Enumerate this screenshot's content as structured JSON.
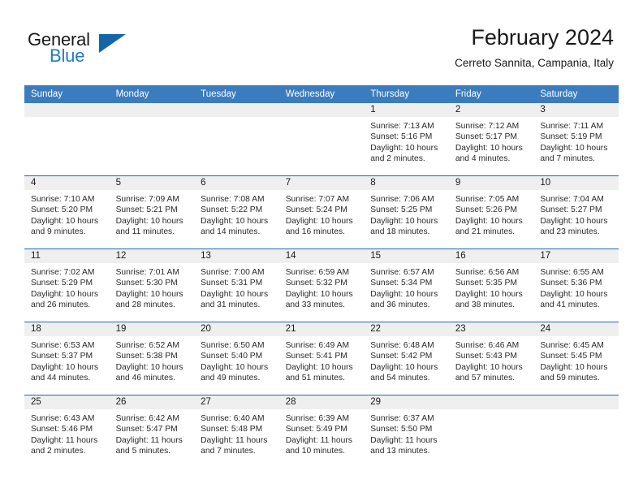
{
  "brand": {
    "name_part1": "General",
    "name_part2": "Blue",
    "flag_icon": "triangle-flag-icon"
  },
  "header": {
    "title": "February 2024",
    "subtitle": "Cerreto Sannita, Campania, Italy"
  },
  "calendar": {
    "weekday_headers": [
      "Sunday",
      "Monday",
      "Tuesday",
      "Wednesday",
      "Thursday",
      "Friday",
      "Saturday"
    ],
    "accent_color": "#3b7cbe",
    "row_divider_color": "#1f6bb0",
    "daynum_bar_color": "#efefef",
    "weeks": [
      [
        {
          "day": "",
          "empty": true,
          "sunrise": "",
          "sunset": "",
          "daylight_line1": "",
          "daylight_line2": ""
        },
        {
          "day": "",
          "empty": true,
          "sunrise": "",
          "sunset": "",
          "daylight_line1": "",
          "daylight_line2": ""
        },
        {
          "day": "",
          "empty": true,
          "sunrise": "",
          "sunset": "",
          "daylight_line1": "",
          "daylight_line2": ""
        },
        {
          "day": "",
          "empty": true,
          "sunrise": "",
          "sunset": "",
          "daylight_line1": "",
          "daylight_line2": ""
        },
        {
          "day": "1",
          "empty": false,
          "sunrise": "Sunrise: 7:13 AM",
          "sunset": "Sunset: 5:16 PM",
          "daylight_line1": "Daylight: 10 hours",
          "daylight_line2": "and 2 minutes."
        },
        {
          "day": "2",
          "empty": false,
          "sunrise": "Sunrise: 7:12 AM",
          "sunset": "Sunset: 5:17 PM",
          "daylight_line1": "Daylight: 10 hours",
          "daylight_line2": "and 4 minutes."
        },
        {
          "day": "3",
          "empty": false,
          "sunrise": "Sunrise: 7:11 AM",
          "sunset": "Sunset: 5:19 PM",
          "daylight_line1": "Daylight: 10 hours",
          "daylight_line2": "and 7 minutes."
        }
      ],
      [
        {
          "day": "4",
          "empty": false,
          "sunrise": "Sunrise: 7:10 AM",
          "sunset": "Sunset: 5:20 PM",
          "daylight_line1": "Daylight: 10 hours",
          "daylight_line2": "and 9 minutes."
        },
        {
          "day": "5",
          "empty": false,
          "sunrise": "Sunrise: 7:09 AM",
          "sunset": "Sunset: 5:21 PM",
          "daylight_line1": "Daylight: 10 hours",
          "daylight_line2": "and 11 minutes."
        },
        {
          "day": "6",
          "empty": false,
          "sunrise": "Sunrise: 7:08 AM",
          "sunset": "Sunset: 5:22 PM",
          "daylight_line1": "Daylight: 10 hours",
          "daylight_line2": "and 14 minutes."
        },
        {
          "day": "7",
          "empty": false,
          "sunrise": "Sunrise: 7:07 AM",
          "sunset": "Sunset: 5:24 PM",
          "daylight_line1": "Daylight: 10 hours",
          "daylight_line2": "and 16 minutes."
        },
        {
          "day": "8",
          "empty": false,
          "sunrise": "Sunrise: 7:06 AM",
          "sunset": "Sunset: 5:25 PM",
          "daylight_line1": "Daylight: 10 hours",
          "daylight_line2": "and 18 minutes."
        },
        {
          "day": "9",
          "empty": false,
          "sunrise": "Sunrise: 7:05 AM",
          "sunset": "Sunset: 5:26 PM",
          "daylight_line1": "Daylight: 10 hours",
          "daylight_line2": "and 21 minutes."
        },
        {
          "day": "10",
          "empty": false,
          "sunrise": "Sunrise: 7:04 AM",
          "sunset": "Sunset: 5:27 PM",
          "daylight_line1": "Daylight: 10 hours",
          "daylight_line2": "and 23 minutes."
        }
      ],
      [
        {
          "day": "11",
          "empty": false,
          "sunrise": "Sunrise: 7:02 AM",
          "sunset": "Sunset: 5:29 PM",
          "daylight_line1": "Daylight: 10 hours",
          "daylight_line2": "and 26 minutes."
        },
        {
          "day": "12",
          "empty": false,
          "sunrise": "Sunrise: 7:01 AM",
          "sunset": "Sunset: 5:30 PM",
          "daylight_line1": "Daylight: 10 hours",
          "daylight_line2": "and 28 minutes."
        },
        {
          "day": "13",
          "empty": false,
          "sunrise": "Sunrise: 7:00 AM",
          "sunset": "Sunset: 5:31 PM",
          "daylight_line1": "Daylight: 10 hours",
          "daylight_line2": "and 31 minutes."
        },
        {
          "day": "14",
          "empty": false,
          "sunrise": "Sunrise: 6:59 AM",
          "sunset": "Sunset: 5:32 PM",
          "daylight_line1": "Daylight: 10 hours",
          "daylight_line2": "and 33 minutes."
        },
        {
          "day": "15",
          "empty": false,
          "sunrise": "Sunrise: 6:57 AM",
          "sunset": "Sunset: 5:34 PM",
          "daylight_line1": "Daylight: 10 hours",
          "daylight_line2": "and 36 minutes."
        },
        {
          "day": "16",
          "empty": false,
          "sunrise": "Sunrise: 6:56 AM",
          "sunset": "Sunset: 5:35 PM",
          "daylight_line1": "Daylight: 10 hours",
          "daylight_line2": "and 38 minutes."
        },
        {
          "day": "17",
          "empty": false,
          "sunrise": "Sunrise: 6:55 AM",
          "sunset": "Sunset: 5:36 PM",
          "daylight_line1": "Daylight: 10 hours",
          "daylight_line2": "and 41 minutes."
        }
      ],
      [
        {
          "day": "18",
          "empty": false,
          "sunrise": "Sunrise: 6:53 AM",
          "sunset": "Sunset: 5:37 PM",
          "daylight_line1": "Daylight: 10 hours",
          "daylight_line2": "and 44 minutes."
        },
        {
          "day": "19",
          "empty": false,
          "sunrise": "Sunrise: 6:52 AM",
          "sunset": "Sunset: 5:38 PM",
          "daylight_line1": "Daylight: 10 hours",
          "daylight_line2": "and 46 minutes."
        },
        {
          "day": "20",
          "empty": false,
          "sunrise": "Sunrise: 6:50 AM",
          "sunset": "Sunset: 5:40 PM",
          "daylight_line1": "Daylight: 10 hours",
          "daylight_line2": "and 49 minutes."
        },
        {
          "day": "21",
          "empty": false,
          "sunrise": "Sunrise: 6:49 AM",
          "sunset": "Sunset: 5:41 PM",
          "daylight_line1": "Daylight: 10 hours",
          "daylight_line2": "and 51 minutes."
        },
        {
          "day": "22",
          "empty": false,
          "sunrise": "Sunrise: 6:48 AM",
          "sunset": "Sunset: 5:42 PM",
          "daylight_line1": "Daylight: 10 hours",
          "daylight_line2": "and 54 minutes."
        },
        {
          "day": "23",
          "empty": false,
          "sunrise": "Sunrise: 6:46 AM",
          "sunset": "Sunset: 5:43 PM",
          "daylight_line1": "Daylight: 10 hours",
          "daylight_line2": "and 57 minutes."
        },
        {
          "day": "24",
          "empty": false,
          "sunrise": "Sunrise: 6:45 AM",
          "sunset": "Sunset: 5:45 PM",
          "daylight_line1": "Daylight: 10 hours",
          "daylight_line2": "and 59 minutes."
        }
      ],
      [
        {
          "day": "25",
          "empty": false,
          "sunrise": "Sunrise: 6:43 AM",
          "sunset": "Sunset: 5:46 PM",
          "daylight_line1": "Daylight: 11 hours",
          "daylight_line2": "and 2 minutes."
        },
        {
          "day": "26",
          "empty": false,
          "sunrise": "Sunrise: 6:42 AM",
          "sunset": "Sunset: 5:47 PM",
          "daylight_line1": "Daylight: 11 hours",
          "daylight_line2": "and 5 minutes."
        },
        {
          "day": "27",
          "empty": false,
          "sunrise": "Sunrise: 6:40 AM",
          "sunset": "Sunset: 5:48 PM",
          "daylight_line1": "Daylight: 11 hours",
          "daylight_line2": "and 7 minutes."
        },
        {
          "day": "28",
          "empty": false,
          "sunrise": "Sunrise: 6:39 AM",
          "sunset": "Sunset: 5:49 PM",
          "daylight_line1": "Daylight: 11 hours",
          "daylight_line2": "and 10 minutes."
        },
        {
          "day": "29",
          "empty": false,
          "sunrise": "Sunrise: 6:37 AM",
          "sunset": "Sunset: 5:50 PM",
          "daylight_line1": "Daylight: 11 hours",
          "daylight_line2": "and 13 minutes."
        },
        {
          "day": "",
          "empty": true,
          "sunrise": "",
          "sunset": "",
          "daylight_line1": "",
          "daylight_line2": ""
        },
        {
          "day": "",
          "empty": true,
          "sunrise": "",
          "sunset": "",
          "daylight_line1": "",
          "daylight_line2": ""
        }
      ]
    ]
  }
}
